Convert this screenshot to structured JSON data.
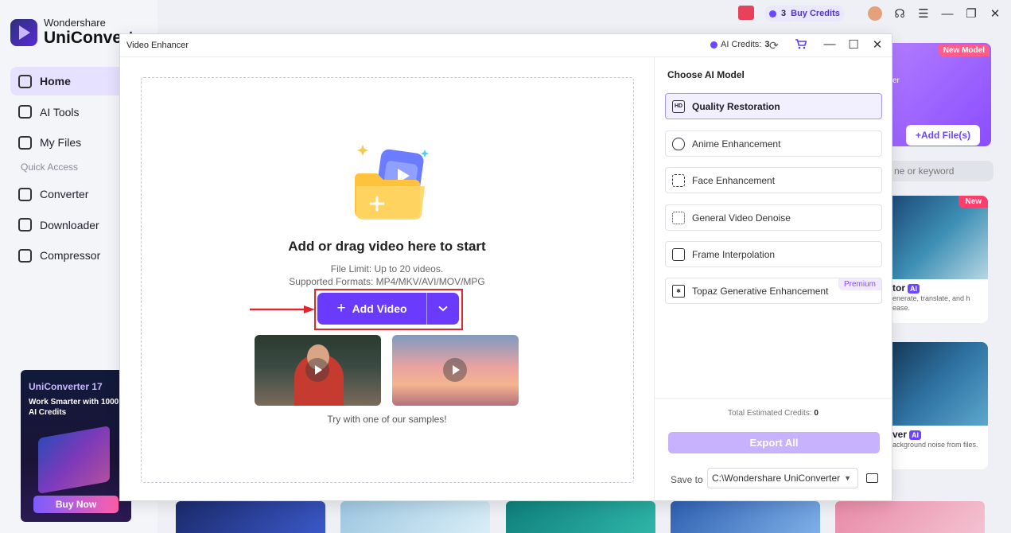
{
  "app": {
    "brand_line1": "Wondershare",
    "brand_line2": "UniConverter",
    "nav": {
      "home": "Home",
      "ai_tools": "AI Tools",
      "my_files": "My Files",
      "quick_access": "Quick Access",
      "converter": "Converter",
      "downloader": "Downloader",
      "compressor": "Compressor"
    },
    "promo": {
      "title": "UniConverter 17",
      "subtitle": "Work Smarter with 1000 AI Credits",
      "button": "Buy Now"
    },
    "topbar": {
      "credits_count": "3",
      "buy_credits": "Buy Credits"
    },
    "background_panel": {
      "new_model_badge": "New Model",
      "card_fragment": "er",
      "add_files": "+Add File(s)",
      "search_placeholder": "ne or keyword",
      "tile1_badge": "New",
      "tile1_title": "tor",
      "tile1_desc": "enerate, translate, and h ease.",
      "tile2_title": "ver",
      "tile2_desc": "ackground noise from files.",
      "ai_badge": "AI"
    }
  },
  "modal": {
    "title": "Video Enhancer",
    "ai_credits_label": "AI Credits:",
    "ai_credits_value": "3",
    "drop_heading": "Add or drag video here to start",
    "file_limit": "File Limit: Up to 20 videos.",
    "formats": "Supported Formats: MP4/MKV/AVI/MOV/MPG",
    "add_video": "Add Video",
    "samples_caption": "Try with one of our samples!",
    "model_panel_title": "Choose AI Model",
    "models": [
      {
        "label": "Quality Restoration",
        "icon": "hd-icon",
        "icon_text": "HD"
      },
      {
        "label": "Anime Enhancement",
        "icon": "anime-icon",
        "icon_text": ""
      },
      {
        "label": "Face Enhancement",
        "icon": "face-scan-icon",
        "icon_text": ""
      },
      {
        "label": "General Video Denoise",
        "icon": "denoise-icon",
        "icon_text": ""
      },
      {
        "label": "Frame Interpolation",
        "icon": "frame-icon",
        "icon_text": ""
      },
      {
        "label": "Topaz Generative Enhancement",
        "icon": "topaz-icon",
        "icon_text": "",
        "badge": "Premium"
      }
    ],
    "total_label": "Total Estimated Credits:",
    "total_value": "0",
    "export_all": "Export All",
    "save_to_label": "Save to",
    "save_path": "C:\\Wondershare UniConverter"
  },
  "colors": {
    "accent": "#6a3bff",
    "highlight": "#e1262e",
    "export_disabled": "#c8b2ff"
  }
}
